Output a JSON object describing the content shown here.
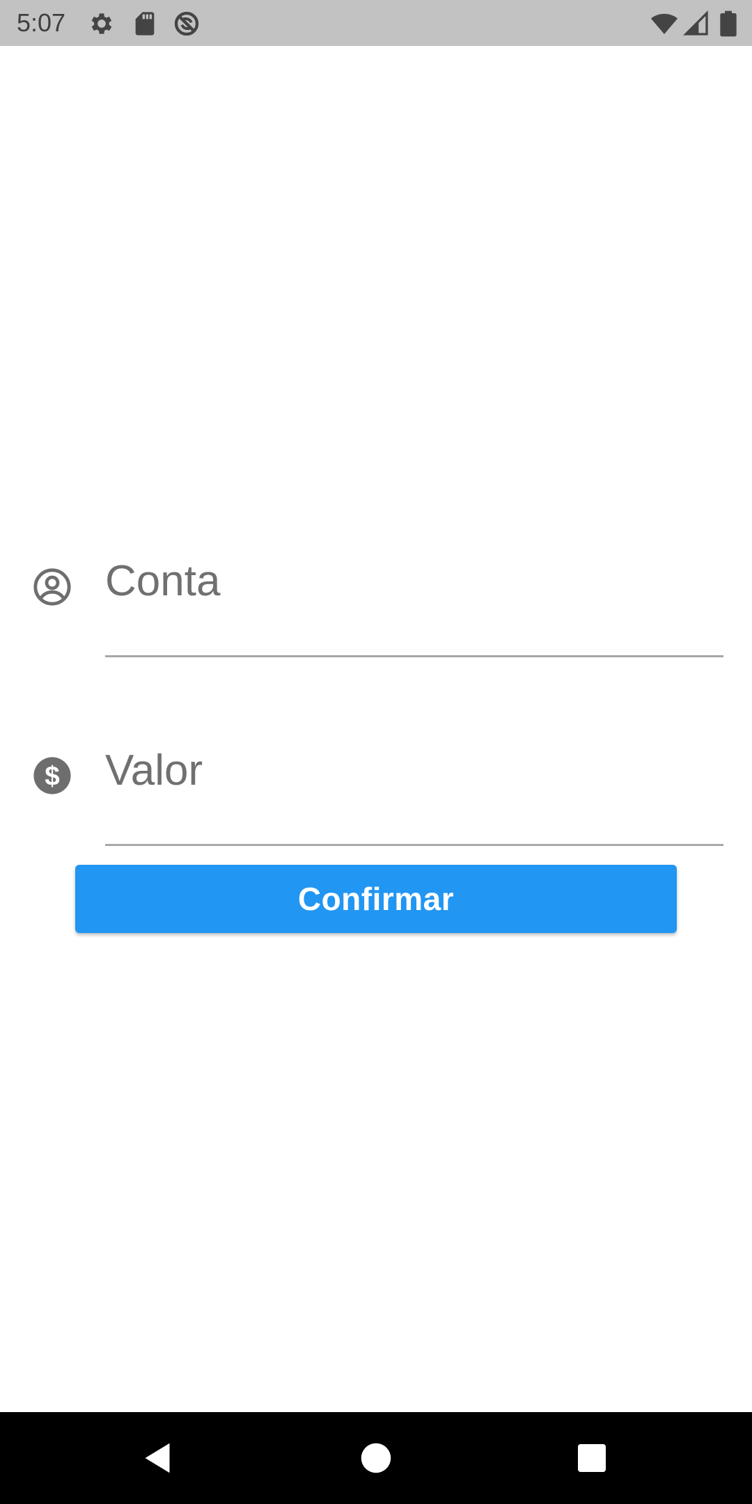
{
  "status_bar": {
    "time": "5:07",
    "icons": [
      "gear-icon",
      "sd-card-icon",
      "no-sync-icon",
      "wifi-icon",
      "cell-signal-icon",
      "battery-icon"
    ],
    "background": "#c2c2c2"
  },
  "form": {
    "account": {
      "placeholder": "Conta",
      "value": "",
      "icon": "account-circle-icon"
    },
    "amount": {
      "placeholder": "Valor",
      "value": "",
      "icon": "dollar-circle-icon"
    },
    "confirm_label": "Confirmar",
    "accent_color": "#2196f3"
  },
  "nav_bar": {
    "buttons": [
      "back-icon",
      "home-icon",
      "recents-icon"
    ]
  }
}
